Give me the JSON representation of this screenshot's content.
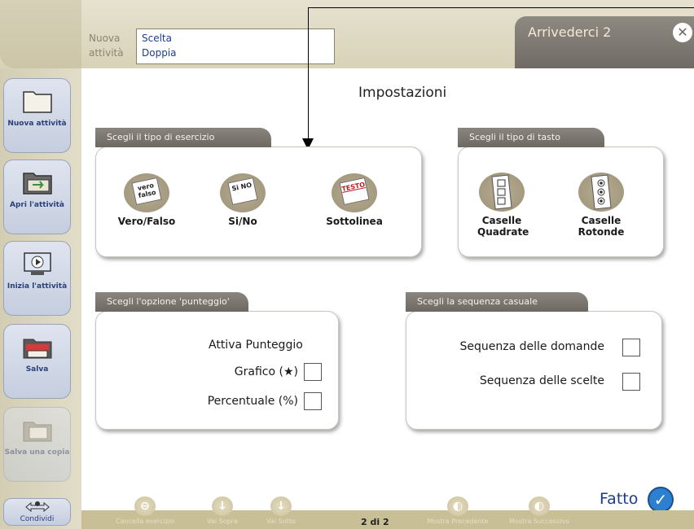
{
  "header": {
    "name_label": "Nuova attività",
    "name_value": "Scelta Doppia",
    "title": "Arrivederci 2",
    "close": "✕"
  },
  "sidebar": {
    "items": [
      {
        "label": "Nuova attività",
        "icon": "folder-icon"
      },
      {
        "label": "Apri l'attività",
        "icon": "open-folder-icon"
      },
      {
        "label": "Inizia l'attività",
        "icon": "play-icon"
      },
      {
        "label": "Salva",
        "icon": "save-icon"
      },
      {
        "label": "Salva una copia",
        "icon": "save-copy-icon"
      },
      {
        "label": "Condividi",
        "icon": "share-icon"
      }
    ]
  },
  "main": {
    "title": "Impostazioni",
    "exercise_type": {
      "tab": "Scegli il tipo di esercizio",
      "options": [
        {
          "label": "Vero/Falso",
          "card_text": "vero falso"
        },
        {
          "label": "Si/No",
          "card_text": "Si NO"
        },
        {
          "label": "Sottolinea",
          "card_text": "TESTO"
        }
      ]
    },
    "button_type": {
      "tab": "Scegli il tipo di tasto",
      "options": [
        {
          "label": "Caselle Quadrate"
        },
        {
          "label": "Caselle Rotonde"
        }
      ]
    },
    "score": {
      "tab": "Scegli l'opzione 'punteggio'",
      "title": "Attiva Punteggio",
      "rows": [
        {
          "label": "Grafico (★)",
          "checked": false
        },
        {
          "label": "Percentuale (%)",
          "checked": false
        }
      ]
    },
    "random": {
      "tab": "Scegli la sequenza casuale",
      "rows": [
        {
          "label": "Sequenza delle domande",
          "checked": false
        },
        {
          "label": "Sequenza delle scelte",
          "checked": false
        }
      ]
    },
    "done_label": "Fatto",
    "done_icon": "✓"
  },
  "bottom": {
    "items": [
      {
        "label": "Cancella esercizio"
      },
      {
        "label": "Vai Sopra"
      },
      {
        "label": "Vai Sotto"
      },
      {
        "label": "Mostra Precedente"
      },
      {
        "label": "Mostra Successivo"
      }
    ],
    "page": "2 di 2"
  }
}
